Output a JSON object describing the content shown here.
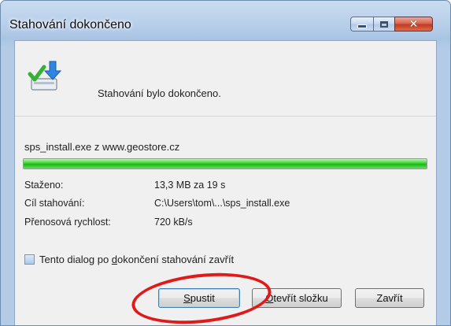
{
  "window": {
    "title": "Stahování dokončeno",
    "controls": {
      "minimize": "minimize-icon",
      "maximize": "maximize-icon",
      "close": "close-icon"
    }
  },
  "message": "Stahování bylo dokončeno.",
  "file": {
    "name": "sps_install.exe z www.geostore.cz",
    "progress_percent": 100
  },
  "details": [
    {
      "label": "Staženo:",
      "value": "13,3 MB za 19 s"
    },
    {
      "label": "Cíl stahování:",
      "value": "C:\\Users\\tom\\...\\sps_install.exe"
    },
    {
      "label": "Přenosová rychlost:",
      "value": "720 kB/s"
    }
  ],
  "checkbox": {
    "checked": false,
    "label_pre": "Tento dialog po ",
    "label_access": "d",
    "label_post": "okončení stahování zavřít"
  },
  "buttons": {
    "run": {
      "access": "S",
      "rest": "pustit"
    },
    "open_folder": {
      "access": "O",
      "rest": "tevřít složku"
    },
    "close": "Zavřít"
  },
  "colors": {
    "progress_green": "#1cb61a",
    "highlight_ring": "#e0191a",
    "close_button": "#c23a22"
  },
  "icons": {
    "download_complete": "download-complete-icon"
  }
}
